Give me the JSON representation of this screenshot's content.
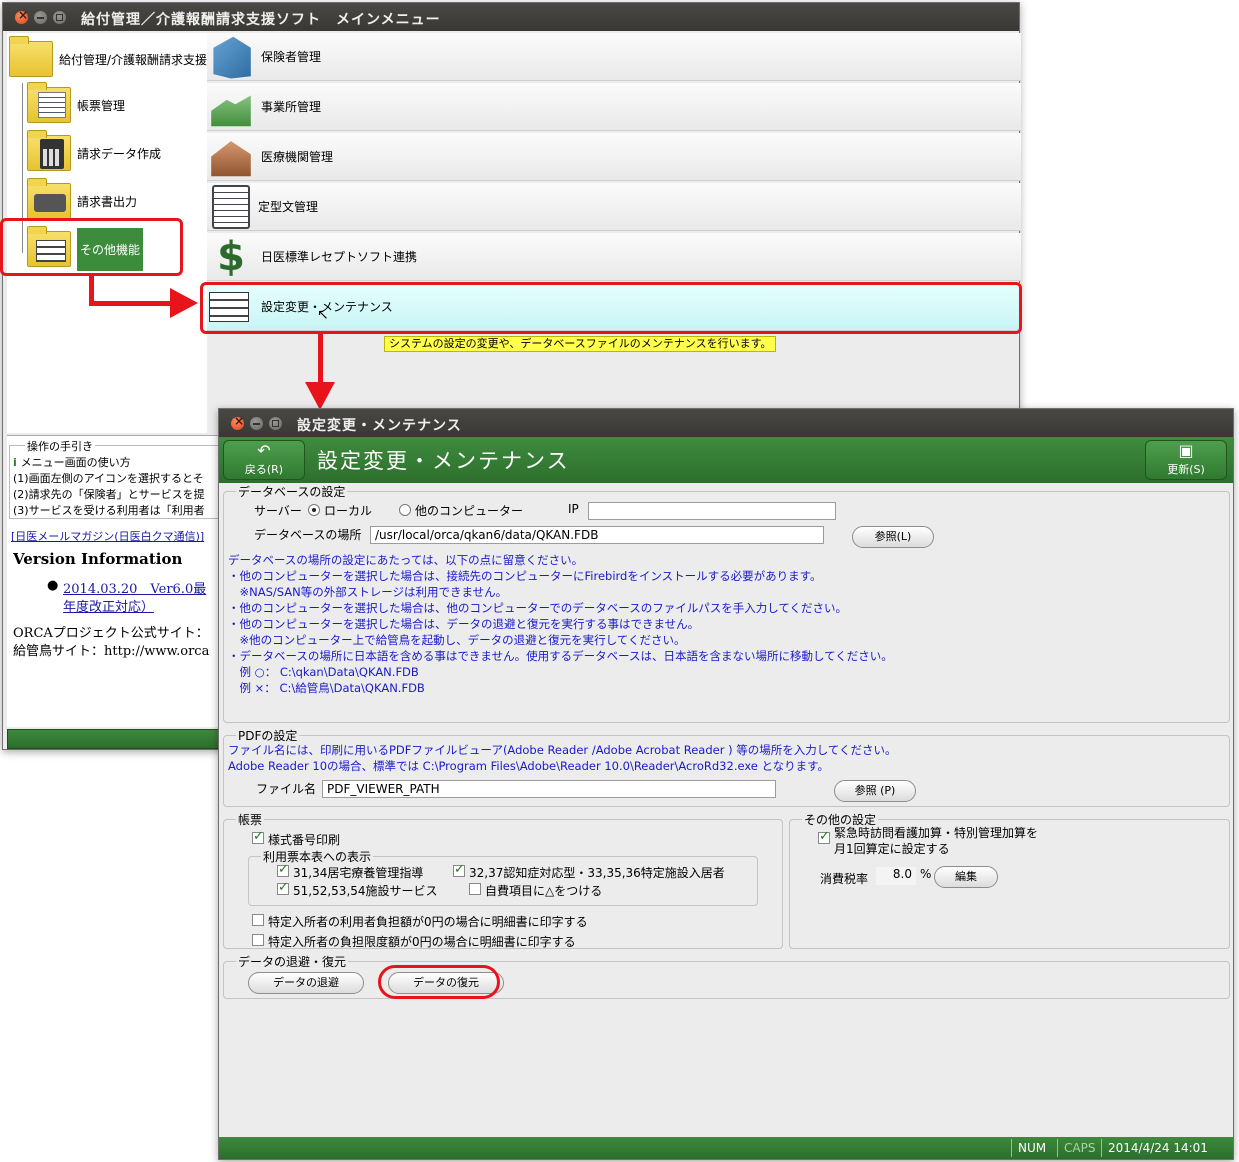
{
  "main_window": {
    "title": "給付管理／介護報酬請求支援ソフト　メインメニュー",
    "tree": {
      "root": "給付管理/介護報酬請求支援",
      "items": [
        "帳票管理",
        "請求データ作成",
        "請求書出力",
        "その他機能"
      ]
    },
    "menu_items": [
      {
        "label": "保険者管理",
        "icon": "building-icon"
      },
      {
        "label": "事業所管理",
        "icon": "factory-icon"
      },
      {
        "label": "医療機関管理",
        "icon": "hospital-icon"
      },
      {
        "label": "定型文管理",
        "icon": "document-icon"
      },
      {
        "label": "日医標準レセプトソフト連携",
        "icon": "jma-logo-icon"
      },
      {
        "label": "設定変更・メンテナンス",
        "icon": "settings-grid-icon"
      }
    ],
    "tooltip": "システムの設定の変更や、データベースファイルのメンテナンスを行います。",
    "help": {
      "title": "操作の手引き",
      "lines": [
        "メニュー画面の使い方",
        "(1)画面左側のアイコンを選択するとそ",
        "(2)請求先の「保険者」とサービスを提",
        "(3)サービスを受ける利用者は「利用者"
      ],
      "mail_link": "[日医メールマガジン(日医白クマ通信)]",
      "version_title": "Version Information",
      "version_item_line1": "2014.03.20　Ver6.0最",
      "version_item_line2": "年度改正対応）",
      "orca_site": "ORCAプロジェクト公式サイト：",
      "kyufu_site": "給管鳥サイト：http://www.orca"
    }
  },
  "settings_window": {
    "title": "設定変更・メンテナンス",
    "header_title": "設定変更・メンテナンス",
    "back_button": "戻る(R)",
    "update_button": "更新(S)",
    "database": {
      "legend": "データベースの設定",
      "server_label": "サーバー",
      "radio_local": "ローカル",
      "radio_other": "他のコンピューター",
      "selected": "ローカル",
      "ip_label": "IP",
      "ip_value": "",
      "location_label": "データベースの場所",
      "location_value": "/usr/local/orca/qkan6/data/QKAN.FDB",
      "browse_button": "参照(L)",
      "notes": [
        "データベースの場所の設定にあたっては、以下の点に留意ください。",
        "・他のコンピューターを選択した場合は、接続先のコンピューターにFirebirdをインストールする必要があります。",
        "　※NAS/SAN等の外部ストレージは利用できません。",
        "・他のコンピューターを選択した場合は、他のコンピューターでのデータベースのファイルパスを手入力してください。",
        "・他のコンピューターを選択した場合は、データの退避と復元を実行する事はできません。",
        "　※他のコンピューター上で給管鳥を起動し、データの退避と復元を実行してください。",
        "・データベースの場所に日本語を含める事はできません。使用するデータベースは、日本語を含まない場所に移動してください。",
        "　例 ○：  C:\\qkan\\Data\\QKAN.FDB",
        "　例 ×：  C:\\給管鳥\\Data\\QKAN.FDB"
      ]
    },
    "pdf": {
      "legend": "PDFの設定",
      "notes": [
        "ファイル名には、印刷に用いるPDFファイルビューア(Adobe Reader /Adobe Acrobat Reader ) 等の場所を入力してください。",
        "Adobe Reader 10の場合、標準では C:\\Program Files\\Adobe\\Reader 10.0\\Reader\\AcroRd32.exe となります。"
      ],
      "file_label": "ファイル名",
      "file_value": "PDF_VIEWER_PATH",
      "browse_button": "参照 (P)"
    },
    "forms": {
      "legend": "帳票",
      "print_form_number": {
        "label": "様式番号印刷",
        "checked": true
      },
      "usage_display_legend": "利用票本表への表示",
      "opt_31_34": {
        "label": "31,34居宅療養管理指導",
        "checked": true
      },
      "opt_32_37": {
        "label": "32,37認知症対応型・33,35,36特定施設入居者",
        "checked": true
      },
      "opt_51_54": {
        "label": "51,52,53,54施設サービス",
        "checked": true
      },
      "opt_self_pay": {
        "label": "自費項目に△をつける",
        "checked": false
      },
      "opt_user_burden_zero": {
        "label": "特定入所者の利用者負担額が0円の場合に明細書に印字する",
        "checked": false
      },
      "opt_limit_zero": {
        "label": "特定入所者の負担限度額が0円の場合に明細書に印字する",
        "checked": false
      }
    },
    "other": {
      "legend": "その他の設定",
      "emergency_line1": "緊急時訪問看護加算・特別管理加算を",
      "emergency_line2": "月1回算定に設定する",
      "emergency_checked": true,
      "tax_label": "消費税率",
      "tax_value": "8.0",
      "tax_unit": "%",
      "edit_button": "編集"
    },
    "backup": {
      "legend": "データの退避・復元",
      "backup_button": "データの退避",
      "restore_button": "データの復元"
    },
    "status": {
      "num": "NUM",
      "caps": "CAPS",
      "datetime": "2014/4/24 14:01"
    }
  },
  "colors": {
    "highlight_red": "#e8141b",
    "header_green": "#2f7a2f",
    "note_blue": "#1a1acc",
    "tooltip_yellow": "#ffff4c"
  }
}
